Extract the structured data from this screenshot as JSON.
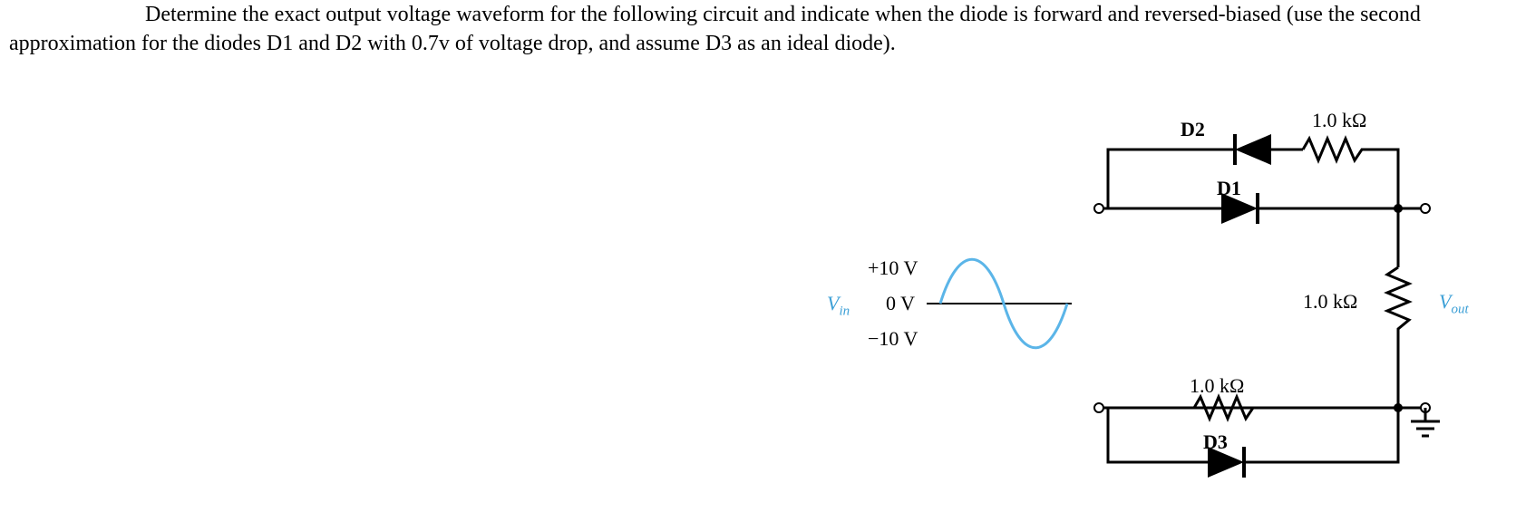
{
  "problem": {
    "text_part1": "Determine the exact output voltage waveform for the following circuit and indicate when the diode is forward and reversed-biased (use the second approximation for the diodes D1 and D2 with 0.7v of voltage drop, and assume D3 as an ideal diode)."
  },
  "circuit": {
    "components": {
      "D1": "D1",
      "D2": "D2",
      "D3": "D3",
      "R_top": "1.0 kΩ",
      "R_out": "1.0 kΩ",
      "R_bottom": "1.0 kΩ"
    },
    "input": {
      "label": "V",
      "label_sub": "in",
      "top_val": "+10 V",
      "mid_val": "0 V",
      "bot_val": "−10 V"
    },
    "output": {
      "label": "V",
      "label_sub": "out"
    }
  }
}
